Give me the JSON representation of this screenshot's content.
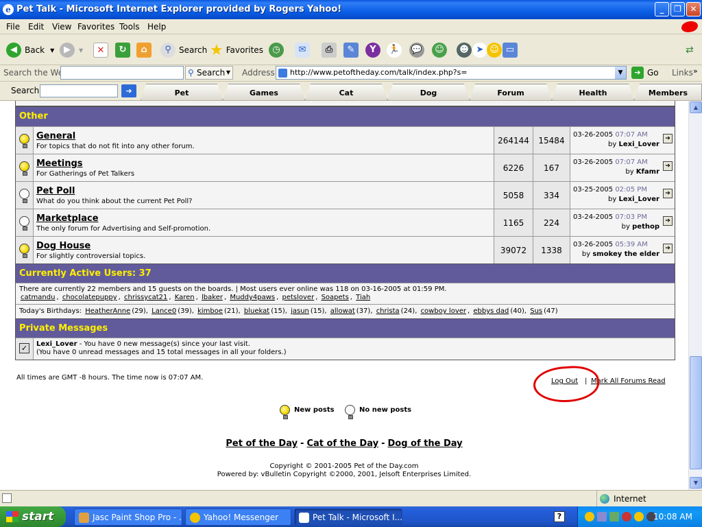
{
  "window": {
    "title": "Pet Talk - Microsoft Internet Explorer provided by Rogers Yahoo!"
  },
  "menu": [
    "File",
    "Edit",
    "View",
    "Favorites",
    "Tools",
    "Help"
  ],
  "toolbar": {
    "back": "Back",
    "search": "Search",
    "favorites": "Favorites"
  },
  "addressbar": {
    "search_label": "Search the Web",
    "search_btn": "Search",
    "address_label": "Address",
    "url": "http://www.petoftheday.com/talk/index.php?s=",
    "go": "Go",
    "links": "Links"
  },
  "navbar": {
    "search_label": "Search",
    "tabs": [
      "Pet",
      "Games",
      "Cat",
      "Dog",
      "Forum",
      "Health",
      "Members"
    ]
  },
  "section_other": "Other",
  "forums": [
    {
      "name": "General",
      "desc": "For topics that do not fit into any other forum.",
      "posts": "264144",
      "threads": "15484",
      "date": "03-26-2005",
      "time": "07:07 AM",
      "by": "by",
      "user": "Lexi_Lover",
      "new": true
    },
    {
      "name": "Meetings",
      "desc": "For Gatherings of Pet Talkers",
      "posts": "6226",
      "threads": "167",
      "date": "03-26-2005",
      "time": "07:07 AM",
      "by": "by",
      "user": "Kfamr",
      "new": true
    },
    {
      "name": "Pet Poll",
      "desc": "What do you think about the current Pet Poll?",
      "posts": "5058",
      "threads": "334",
      "date": "03-25-2005",
      "time": "02:05 PM",
      "by": "by",
      "user": "Lexi_Lover",
      "new": false
    },
    {
      "name": "Marketplace",
      "desc": "The only forum for Advertising and Self-promotion.",
      "posts": "1165",
      "threads": "224",
      "date": "03-24-2005",
      "time": "07:03 PM",
      "by": "by",
      "user": "pethop",
      "new": false
    },
    {
      "name": "Dog House",
      "desc": "For slightly controversial topics.",
      "posts": "39072",
      "threads": "1338",
      "date": "03-26-2005",
      "time": "05:39 AM",
      "by": "by",
      "user": "smokey the elder",
      "new": true
    }
  ],
  "active": {
    "header": "Currently Active Users: 37",
    "summary": "There are currently 22 members and 15 guests on the boards. | Most users ever online was 118 on 03-16-2005 at 01:59 PM.",
    "users": [
      "catmandu",
      "chocolatepuppy",
      "chrissycat21",
      "Karen",
      "lbaker",
      "Muddy4paws",
      "petslover",
      "Soapets",
      "Tiah"
    ],
    "birthdays_label": "Today's Birthdays:",
    "birthdays": [
      {
        "name": "HeatherAnne",
        "age": "(29)"
      },
      {
        "name": "Lance0",
        "age": "(39)"
      },
      {
        "name": "kimboe",
        "age": "(21)"
      },
      {
        "name": "bluekat",
        "age": "(15)"
      },
      {
        "name": "jasun",
        "age": "(15)"
      },
      {
        "name": "allowat",
        "age": "(37)"
      },
      {
        "name": "christa",
        "age": "(24)"
      },
      {
        "name": "cowboy lover",
        "age": ""
      },
      {
        "name": "ebbys dad",
        "age": "(40)"
      },
      {
        "name": "Sus",
        "age": "(47)"
      }
    ]
  },
  "pm": {
    "header": "Private Messages",
    "user": "Lexi_Lover",
    "line1": " - You have 0 new message(s) since your last visit.",
    "line2": "(You have 0 unread messages and 15 total messages in all your folders.)"
  },
  "footer": {
    "times": "All times are GMT -8 hours. The time now is 07:07 AM.",
    "logout": "Log Out",
    "separator": "|",
    "mark_read": "Mark All Forums Read",
    "legend_new": "New posts",
    "legend_nonew": "No new posts",
    "site_links": [
      "Pet of the Day",
      "Cat of the Day",
      "Dog of the Day"
    ],
    "link_sep": "-",
    "copyright": "Copyright © 2001-2005 Pet of the Day.com",
    "powered": "Powered by: vBulletin Copyright ©2000, 2001, Jelsoft Enterprises Limited."
  },
  "status": {
    "zone": "Internet"
  },
  "taskbar": {
    "start": "start",
    "tasks": [
      "Jasc Paint Shop Pro - ...",
      "Yahoo! Messenger",
      "Pet Talk - Microsoft I..."
    ],
    "clock": "10:08 AM",
    "help": "?"
  }
}
